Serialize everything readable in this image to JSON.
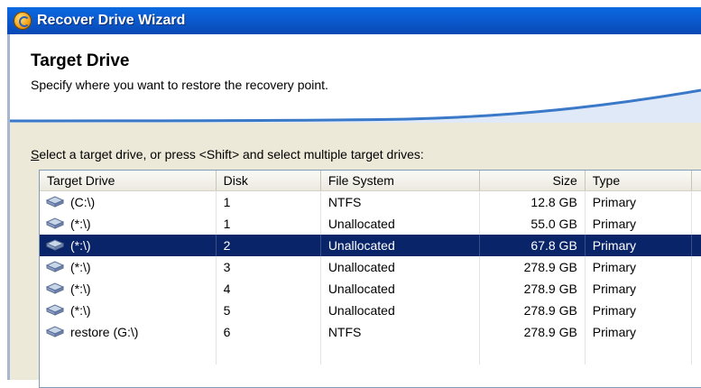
{
  "window": {
    "title": "Recover Drive Wizard",
    "icon": "wizard-app-icon"
  },
  "header": {
    "title": "Target Drive",
    "subtitle": "Specify where you want to restore the recovery point."
  },
  "instruction": {
    "accel": "S",
    "rest": "elect a target drive, or press <Shift> and select multiple target drives:"
  },
  "table": {
    "columns": [
      "Target Drive",
      "Disk",
      "File System",
      "Size",
      "Type",
      ""
    ],
    "selected_index": 2,
    "rows": [
      {
        "drive": "(C:\\)",
        "disk": "1",
        "fs": "NTFS",
        "size": "12.8 GB",
        "type": "Primary"
      },
      {
        "drive": "(*:\\)",
        "disk": "1",
        "fs": "Unallocated",
        "size": "55.0 GB",
        "type": "Primary"
      },
      {
        "drive": "(*:\\)",
        "disk": "2",
        "fs": "Unallocated",
        "size": "67.8 GB",
        "type": "Primary"
      },
      {
        "drive": "(*:\\)",
        "disk": "3",
        "fs": "Unallocated",
        "size": "278.9 GB",
        "type": "Primary"
      },
      {
        "drive": "(*:\\)",
        "disk": "4",
        "fs": "Unallocated",
        "size": "278.9 GB",
        "type": "Primary"
      },
      {
        "drive": "(*:\\)",
        "disk": "5",
        "fs": "Unallocated",
        "size": "278.9 GB",
        "type": "Primary"
      },
      {
        "drive": "restore (G:\\)",
        "disk": "6",
        "fs": "NTFS",
        "size": "278.9 GB",
        "type": "Primary"
      },
      {
        "drive": "",
        "disk": "",
        "fs": "",
        "size": "",
        "type": ""
      }
    ]
  },
  "colors": {
    "titlebar": "#0b5cd2",
    "selection": "#0a246a",
    "swoosh": "#3a78c8"
  }
}
